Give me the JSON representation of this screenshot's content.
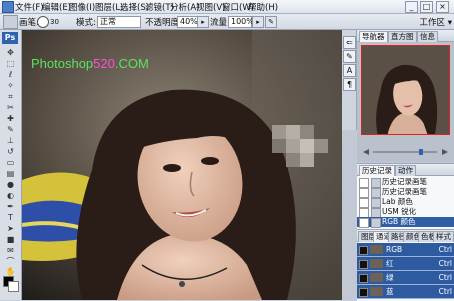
{
  "menubar": {
    "items": [
      "文件(F)",
      "编辑(E)",
      "图像(I)",
      "图层(L)",
      "选择(S)",
      "滤镜(T)",
      "分析(A)",
      "视图(V)",
      "窗口(W)",
      "帮助(H)"
    ]
  },
  "options": {
    "brush_label": "画笔:",
    "brush_size": "30",
    "mode_label": "模式:",
    "mode_value": "正常",
    "opacity_label": "不透明度:",
    "opacity_value": "40%",
    "flow_label": "流量:",
    "flow_value": "100%",
    "workspace_label": "工作区"
  },
  "toolbar": {
    "ps_label": "Ps"
  },
  "canvas": {
    "watermark_part1": "Photoshop",
    "watermark_part2": "520",
    "watermark_part3": ".COM"
  },
  "navigator": {
    "tabs": [
      "导航器",
      "直方图",
      "信息"
    ]
  },
  "history": {
    "tabs": [
      "历史记录",
      "动作"
    ],
    "items": [
      "历史记录画笔",
      "历史记录画笔",
      "Lab 颜色",
      "USM 锐化",
      "RGB 颜色"
    ],
    "selected_index": 4
  },
  "channels": {
    "tabs": [
      "图层",
      "通道",
      "路径",
      "颜色",
      "色板",
      "样式"
    ],
    "rows": [
      {
        "name": "RGB",
        "shortcut": "Ctrl"
      },
      {
        "name": "红",
        "shortcut": "Ctrl"
      },
      {
        "name": "绿",
        "shortcut": "Ctrl"
      },
      {
        "name": "蓝",
        "shortcut": "Ctrl"
      }
    ]
  },
  "colors": {
    "selection_blue": "#2e5ba0",
    "watermark_green": "#5ee25e",
    "watermark_pink": "#ff4fd8",
    "navigator_box": "#e02020"
  }
}
